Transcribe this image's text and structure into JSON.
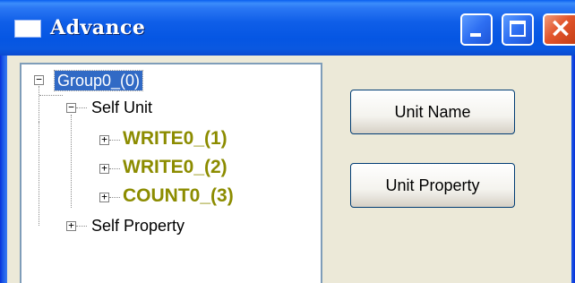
{
  "window": {
    "title": "Advance",
    "buttons": {
      "minimize": "minimize-icon",
      "maximize": "maximize-icon",
      "close": "close-icon"
    },
    "colors": {
      "titlebar": "#0556e3",
      "close_button": "#e2552c",
      "client_background": "#ece9d8"
    }
  },
  "tree": {
    "root": {
      "label": "Group0_(0)",
      "expander": "−",
      "selected": true
    },
    "self_unit": {
      "label": "Self Unit",
      "expander": "−",
      "children": [
        {
          "label": "WRITE0_(1)",
          "expander": "+"
        },
        {
          "label": "WRITE0_(2)",
          "expander": "+"
        },
        {
          "label": "COUNT0_(3)",
          "expander": "+"
        }
      ]
    },
    "self_property": {
      "label": "Self Property",
      "expander": "+"
    },
    "colors": {
      "selection": "#316ac5",
      "unit_text": "#8c8c00"
    }
  },
  "actions": {
    "unit_name_label": "Unit Name",
    "unit_property_label": "Unit Property"
  }
}
